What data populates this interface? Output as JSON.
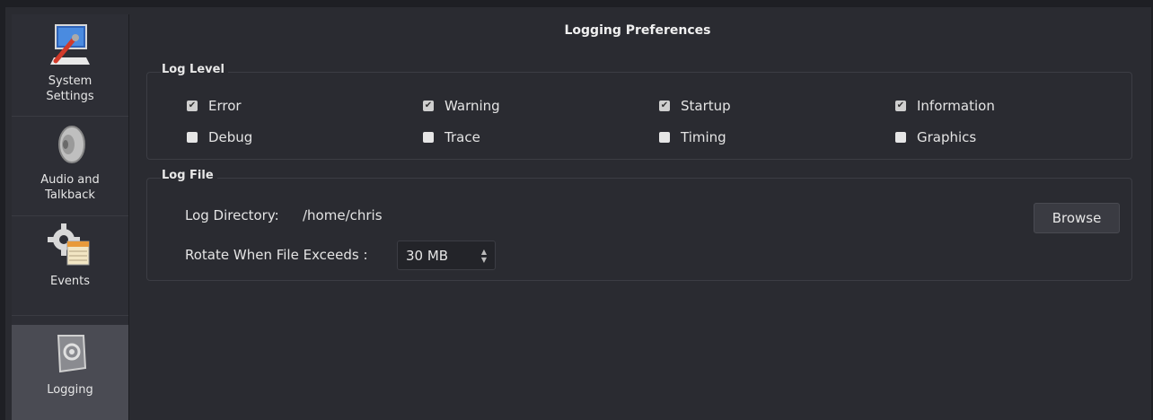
{
  "title": "Logging Preferences",
  "sidebar": {
    "items": [
      {
        "label": "System\nSettings",
        "icon": "system-settings-icon",
        "active": false
      },
      {
        "label": "Audio and\nTalkback",
        "icon": "speaker-icon",
        "active": false
      },
      {
        "label": "Events",
        "icon": "events-gear-icon",
        "active": false
      },
      {
        "label": "Logging",
        "icon": "logging-icon",
        "active": true
      }
    ]
  },
  "log_level": {
    "title": "Log Level",
    "checkboxes": [
      {
        "label": "Error",
        "checked": true
      },
      {
        "label": "Warning",
        "checked": true
      },
      {
        "label": "Startup",
        "checked": true
      },
      {
        "label": "Information",
        "checked": true
      },
      {
        "label": "Debug",
        "checked": false
      },
      {
        "label": "Trace",
        "checked": false
      },
      {
        "label": "Timing",
        "checked": false
      },
      {
        "label": "Graphics",
        "checked": false
      }
    ]
  },
  "log_file": {
    "title": "Log File",
    "directory_label": "Log Directory:",
    "directory_value": "/home/chris",
    "browse_label": "Browse",
    "rotate_label": "Rotate When File Exceeds :",
    "rotate_value": "30 MB"
  },
  "colors": {
    "background": "#2a2b31",
    "sidebar": "#2d2e35",
    "active_item": "#4a4b53",
    "border": "#3c3d44"
  }
}
